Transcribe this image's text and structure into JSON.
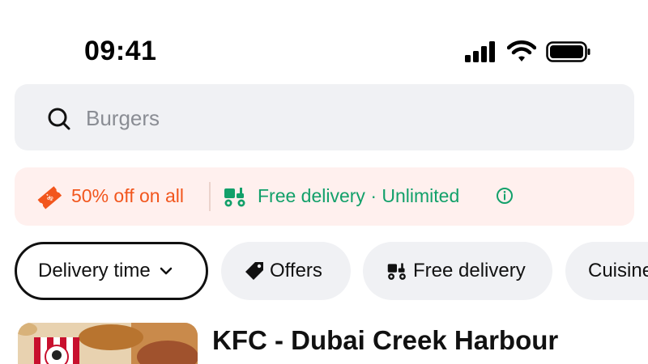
{
  "status_bar": {
    "time": "09:41",
    "icons": [
      "cellular-signal-icon",
      "wifi-icon",
      "battery-icon"
    ]
  },
  "search": {
    "placeholder": "Burgers",
    "value": "",
    "icon": "search-icon"
  },
  "promo": {
    "discount_text": "50% off on all",
    "delivery_text": "Free delivery · Unlimited",
    "discount_color": "#f2561d",
    "delivery_color": "#12a06a",
    "background": "#fff0ee"
  },
  "filters": [
    {
      "label": "Delivery time",
      "icon": "chevron-down-icon",
      "selected": true
    },
    {
      "label": "Offers",
      "icon": "tag-icon",
      "selected": false
    },
    {
      "label": "Free delivery",
      "icon": "scooter-icon",
      "selected": false
    },
    {
      "label": "Cuisine",
      "icon": null,
      "selected": false
    }
  ],
  "restaurant": {
    "name": "KFC - Dubai Creek Harbour"
  },
  "colors": {
    "chip_bg": "#f0f1f4",
    "search_bg": "#f0f1f4",
    "text": "#111111"
  }
}
